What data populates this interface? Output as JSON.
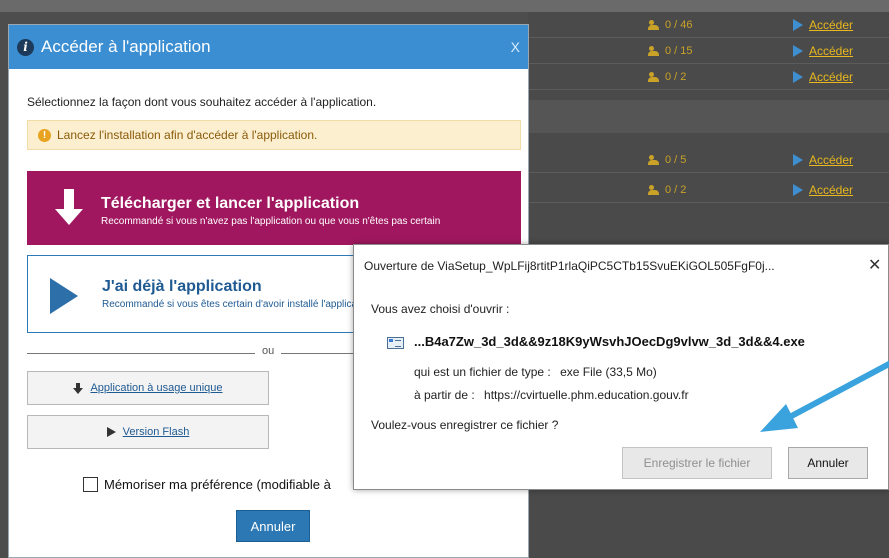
{
  "background": {
    "rows": [
      {
        "count": "0 / 46",
        "action": "Accéder"
      },
      {
        "count": "0 / 15",
        "action": "Accéder"
      },
      {
        "count": "0 / 2",
        "action": "Accéder"
      },
      {
        "count": "0 / 5",
        "action": "Accéder"
      },
      {
        "count": "0 / 2",
        "action": "Accéder"
      }
    ]
  },
  "app_dialog": {
    "title": "Accéder à l'application",
    "close": "X",
    "intro": "Sélectionnez la façon dont vous souhaitez accéder à l'application.",
    "warning": "Lancez l'installation afin d'accéder à l'application.",
    "download": {
      "title": "Télécharger et lancer l'application",
      "subtitle": "Recommandé si vous n'avez pas l'application ou que vous n'êtes pas certain"
    },
    "have_app": {
      "title": "J'ai déjà l'application",
      "subtitle": "Recommandé si vous êtes certain d'avoir installé l'application"
    },
    "or": "ou",
    "single_use": "Application à usage unique",
    "flash": "Version Flash",
    "remember": "Mémoriser ma préférence (modifiable à",
    "cancel": "Annuler"
  },
  "file_dialog": {
    "title": "Ouverture de ViaSetup_WpLFij8rtitP1rlaQiPC5CTb15SvuEKiGOL505FgF0j...",
    "close": "✕",
    "chose_to_open": "Vous avez choisi d'ouvrir :",
    "filename": "...B4a7Zw_3d_3d&&9z18K9yWsvhJOecDg9vlvw_3d_3d&&4.exe",
    "type_label": "qui est un fichier de type :",
    "type_value": "exe File (33,5 Mo)",
    "from_label": "à partir de :",
    "from_value": "https://cvirtuelle.phm.education.gouv.fr",
    "question": "Voulez-vous enregistrer ce fichier ?",
    "save": "Enregistrer le fichier",
    "cancel": "Annuler"
  },
  "colors": {
    "header_blue": "#3a8ed1",
    "download_magenta": "#a0175f",
    "pointer_arrow": "#3aa3dd"
  }
}
